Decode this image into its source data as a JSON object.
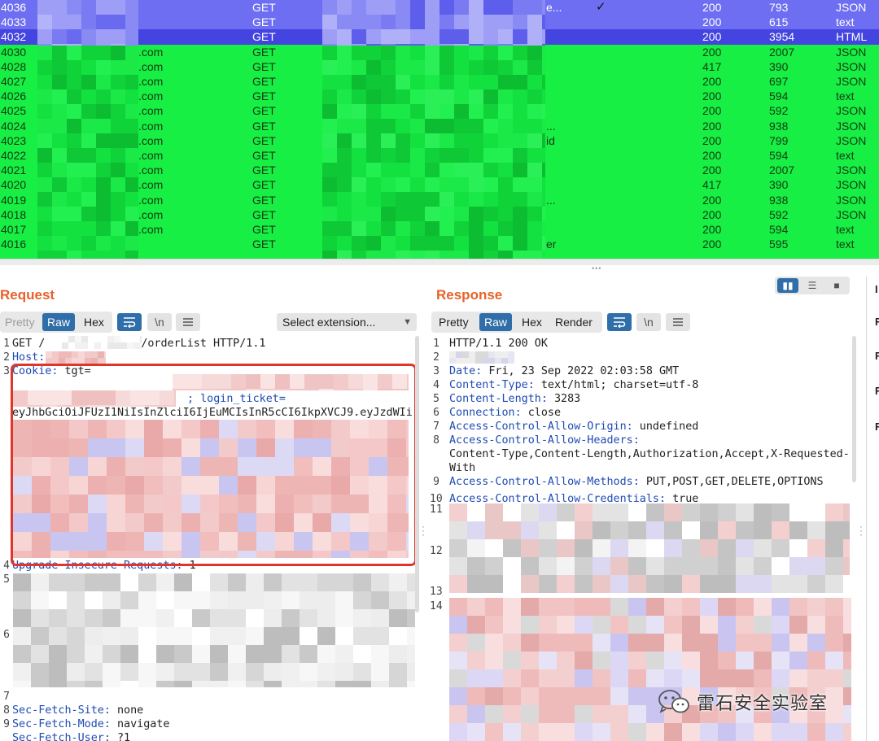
{
  "history": {
    "rows": [
      {
        "id": "4036",
        "host": "",
        "method": "GET",
        "tail": "e...",
        "checked": true,
        "status": "200",
        "length": "793",
        "mime": "JSON",
        "style": "blue"
      },
      {
        "id": "4033",
        "host": "",
        "method": "GET",
        "tail": "",
        "checked": false,
        "status": "200",
        "length": "615",
        "mime": "text",
        "style": "blue"
      },
      {
        "id": "4032",
        "host": "",
        "method": "GET",
        "tail": "",
        "checked": false,
        "status": "200",
        "length": "3954",
        "mime": "HTML",
        "style": "selected"
      },
      {
        "id": "4030",
        "host": ".com",
        "method": "GET",
        "tail": "",
        "checked": false,
        "status": "200",
        "length": "2007",
        "mime": "JSON",
        "style": "green"
      },
      {
        "id": "4028",
        "host": ".com",
        "method": "GET",
        "tail": "",
        "checked": false,
        "status": "417",
        "length": "390",
        "mime": "JSON",
        "style": "green"
      },
      {
        "id": "4027",
        "host": ".com",
        "method": "GET",
        "tail": "",
        "checked": false,
        "status": "200",
        "length": "697",
        "mime": "JSON",
        "style": "green"
      },
      {
        "id": "4026",
        "host": ".com",
        "method": "GET",
        "tail": "",
        "checked": false,
        "status": "200",
        "length": "594",
        "mime": "text",
        "style": "green"
      },
      {
        "id": "4025",
        "host": ".com",
        "method": "GET",
        "tail": "",
        "checked": false,
        "status": "200",
        "length": "592",
        "mime": "JSON",
        "style": "green"
      },
      {
        "id": "4024",
        "host": ".com",
        "method": "GET",
        "tail": "...",
        "checked": false,
        "status": "200",
        "length": "938",
        "mime": "JSON",
        "style": "green"
      },
      {
        "id": "4023",
        "host": ".com",
        "method": "GET",
        "tail": "id",
        "checked": false,
        "status": "200",
        "length": "799",
        "mime": "JSON",
        "style": "green"
      },
      {
        "id": "4022",
        "host": ".com",
        "method": "GET",
        "tail": "",
        "checked": false,
        "status": "200",
        "length": "594",
        "mime": "text",
        "style": "green"
      },
      {
        "id": "4021",
        "host": ".com",
        "method": "GET",
        "tail": "",
        "checked": false,
        "status": "200",
        "length": "2007",
        "mime": "JSON",
        "style": "green"
      },
      {
        "id": "4020",
        "host": ".com",
        "method": "GET",
        "tail": "",
        "checked": false,
        "status": "417",
        "length": "390",
        "mime": "JSON",
        "style": "green"
      },
      {
        "id": "4019",
        "host": ".com",
        "method": "GET",
        "tail": "...",
        "checked": false,
        "status": "200",
        "length": "938",
        "mime": "JSON",
        "style": "green"
      },
      {
        "id": "4018",
        "host": ".com",
        "method": "GET",
        "tail": "",
        "checked": false,
        "status": "200",
        "length": "592",
        "mime": "JSON",
        "style": "green"
      },
      {
        "id": "4017",
        "host": ".com",
        "method": "GET",
        "tail": "",
        "checked": false,
        "status": "200",
        "length": "594",
        "mime": "text",
        "style": "green"
      },
      {
        "id": "4016",
        "host": "",
        "method": "GET",
        "tail": "er",
        "checked": false,
        "status": "200",
        "length": "595",
        "mime": "text",
        "style": "green"
      }
    ],
    "colors": {
      "blue": "#6e6ef2",
      "selected": "#4444e0",
      "green": "#17ef44"
    }
  },
  "request": {
    "title": "Request",
    "tabs": {
      "pretty": "Pretty",
      "raw": "Raw",
      "hex": "Hex"
    },
    "icons": [
      "wrap-icon",
      "newline-icon",
      "menu-icon"
    ],
    "newline_glyph": "\\n",
    "extension_select": "Select extension...",
    "lines": [
      {
        "n": "1",
        "text": "GET /",
        "text2": "/orderList HTTP/1.1"
      },
      {
        "n": "2",
        "key": "Host:",
        "value": ""
      },
      {
        "n": "3",
        "key": "Cookie:",
        "value": " tgt="
      },
      {
        "n": "",
        "key": "",
        "value": "; login_ticket="
      },
      {
        "n": "",
        "key": "",
        "value": "eyJhbGciOiJFUzI1NiIsInZlciI6IjEuMCIsInR5cCI6IkpXVCJ9.eyJzdWIi"
      },
      {
        "n": "4",
        "key": "Upgrade-Insecure-Requests:",
        "value": " 1"
      },
      {
        "n": "5",
        "key": "",
        "value": ""
      },
      {
        "n": "6",
        "key": "",
        "value": ""
      },
      {
        "n": "7",
        "key": "",
        "value": ""
      },
      {
        "n": "8",
        "key": "Sec-Fetch-Site:",
        "value": " none"
      },
      {
        "n": "9",
        "key": "Sec-Fetch-Mode:",
        "value": " navigate"
      },
      {
        "n": "",
        "key": "Sec-Fetch-User:",
        "value": " ?1"
      }
    ]
  },
  "response": {
    "title": "Response",
    "tabs": {
      "pretty": "Pretty",
      "raw": "Raw",
      "hex": "Hex",
      "render": "Render"
    },
    "icons": [
      "wrap-icon",
      "newline-icon",
      "menu-icon"
    ],
    "newline_glyph": "\\n",
    "lines": [
      {
        "n": "1",
        "key": "",
        "value": "HTTP/1.1 200 OK"
      },
      {
        "n": "2",
        "key": "",
        "value": ""
      },
      {
        "n": "3",
        "key": "Date:",
        "value": " Fri, 23 Sep 2022 02:03:58 GMT"
      },
      {
        "n": "4",
        "key": "Content-Type:",
        "value": " text/html; charset=utf-8"
      },
      {
        "n": "5",
        "key": "Content-Length:",
        "value": " 3283"
      },
      {
        "n": "6",
        "key": "Connection:",
        "value": " close"
      },
      {
        "n": "7",
        "key": "Access-Control-Allow-Origin:",
        "value": " undefined"
      },
      {
        "n": "8",
        "key": "Access-Control-Allow-Headers:",
        "value": ""
      },
      {
        "n": "",
        "key": "",
        "value": "Content-Type,Content-Length,Authorization,Accept,X-Requested-"
      },
      {
        "n": "",
        "key": "",
        "value": "With"
      },
      {
        "n": "9",
        "key": "Access-Control-Allow-Methods:",
        "value": " PUT,POST,GET,DELETE,OPTIONS"
      },
      {
        "n": "10",
        "key": "Access-Control-Allow-Credentials:",
        "value": " true"
      },
      {
        "n": "11",
        "key": "",
        "value": ""
      },
      {
        "n": "12",
        "key": "",
        "value": ""
      },
      {
        "n": "13",
        "key": "",
        "value": ""
      },
      {
        "n": "14",
        "key": "",
        "value": ""
      }
    ]
  },
  "inspector": {
    "letters": [
      "I",
      "R",
      "R",
      "R",
      "R"
    ]
  },
  "watermark": {
    "text": "雷石安全实验室"
  },
  "colors": {
    "accent": "#e8622a",
    "tab_active": "#2f6ea8",
    "header_key": "#1f4bb4",
    "highlight": "#e0352b"
  }
}
